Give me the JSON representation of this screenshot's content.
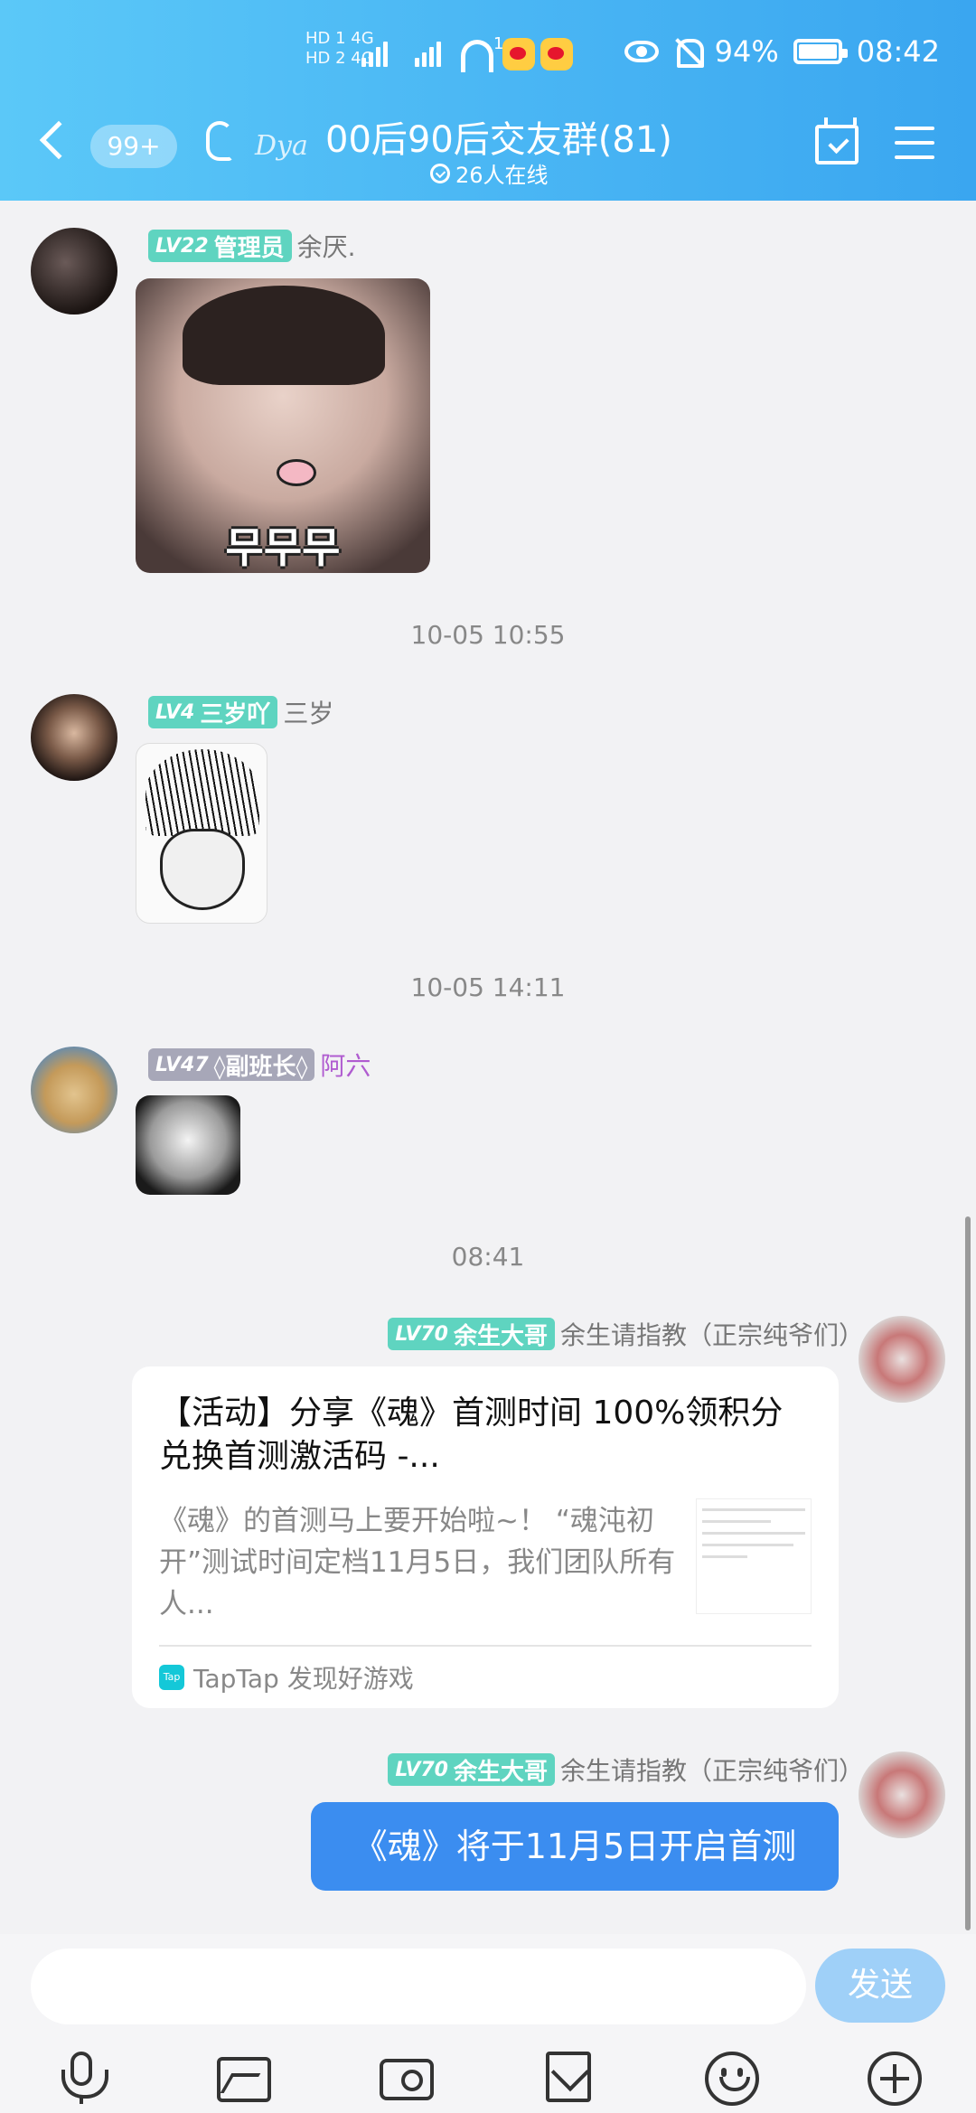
{
  "status_bar": {
    "signal_text": "HD 1 4G\nHD 2 4G",
    "notif_count": "1",
    "battery": "94%",
    "clock": "08:42"
  },
  "header": {
    "unread_badge": "99+",
    "title": "00后90后交友群(81)",
    "online": "26人在线",
    "deco_text": "Dya"
  },
  "messages": [
    {
      "level": "LV22",
      "title": "管理员",
      "nickname": "余厌."
    },
    {
      "time": "10-05 10:55"
    },
    {
      "level": "LV4",
      "title": "三岁吖",
      "nickname": "三岁"
    },
    {
      "time": "10-05 14:11"
    },
    {
      "level": "LV47",
      "title": "◊副班长◊",
      "nickname": "阿六"
    },
    {
      "time": "08:41"
    }
  ],
  "sticker_text": "무무무",
  "card_message": {
    "level": "LV70",
    "title_tag": "余生大哥",
    "nickname": "余生请指教（正宗纯爷们）",
    "title": "【活动】分享《魂》首测时间 100%领积分兑换首测激活码 -...",
    "desc": "《魂》的首测马上要开始啦~！ “魂沌初开”测试时间定档11月5日，我们团队所有人...",
    "source": "TapTap 发现好游戏",
    "tap_logo": "Tap"
  },
  "text_message": {
    "level": "LV70",
    "title_tag": "余生大哥",
    "nickname": "余生请指教（正宗纯爷们）",
    "text": "《魂》将于11月5日开启首测"
  },
  "input_bar": {
    "send_label": "发送"
  },
  "colors": {
    "header_gradient": [
      "#5bc8f8",
      "#3aa6f0"
    ],
    "bubble": "#3b8df0",
    "tag_teal": "#5fd4c0",
    "tag_gray": "#a7a7b8",
    "send": "#9fd0f8"
  }
}
